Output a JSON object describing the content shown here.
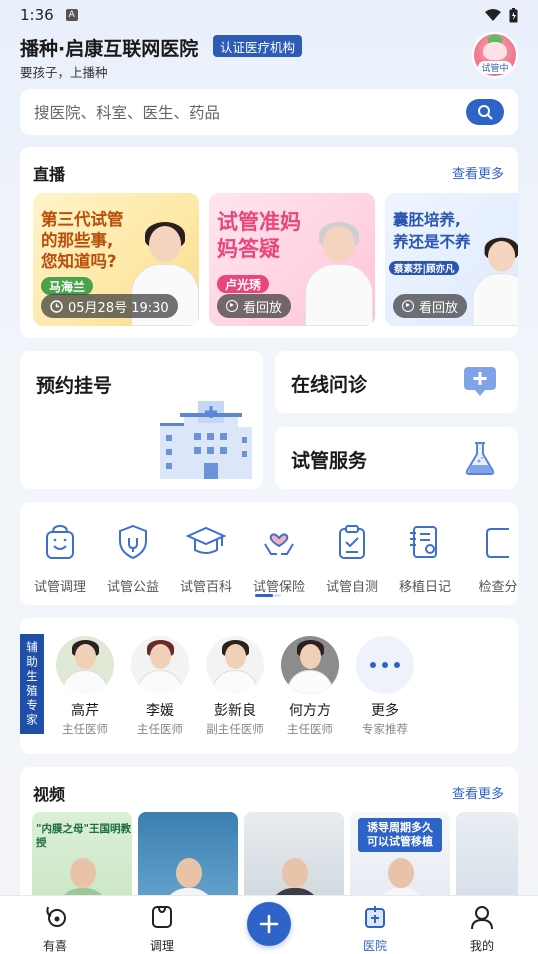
{
  "status_bar": {
    "time": "1:36"
  },
  "header": {
    "title": "播种·启康互联网医院",
    "badge": "认证医疗机构",
    "slogan": "要孩子，上播种",
    "avatar_tag": "试管中"
  },
  "search": {
    "placeholder": "搜医院、科室、医生、药品"
  },
  "live": {
    "title": "直播",
    "more": "查看更多",
    "items": [
      {
        "headline": [
          "第三代试管",
          "的那些事,",
          "您知道吗?"
        ],
        "doctor": "马海兰",
        "time": "05月28号 19:30"
      },
      {
        "headline": [
          "试管准妈",
          "妈答疑"
        ],
        "doctor": "卢光琇",
        "action": "看回放"
      },
      {
        "headline": [
          "囊胚培养,",
          "养还是不养"
        ],
        "doctor": "蔡素芬|顾亦凡",
        "action": "看回放"
      }
    ]
  },
  "services": {
    "appointment": "预约挂号",
    "consultation": "在线问诊",
    "ivf_service": "试管服务"
  },
  "grid": {
    "items": [
      {
        "label": "试管调理",
        "icon": "bag-smile-icon"
      },
      {
        "label": "试管公益",
        "icon": "shield-heart-icon"
      },
      {
        "label": "试管百科",
        "icon": "graduation-cap-icon"
      },
      {
        "label": "试管保险",
        "icon": "hand-heart-icon"
      },
      {
        "label": "试管自测",
        "icon": "clipboard-check-icon"
      },
      {
        "label": "移植日记",
        "icon": "diary-icon"
      },
      {
        "label": "检查分",
        "icon": "report-icon"
      }
    ]
  },
  "experts": {
    "tag": "辅助生殖专家",
    "items": [
      {
        "name": "高芹",
        "role": "主任医师"
      },
      {
        "name": "李媛",
        "role": "主任医师"
      },
      {
        "name": "彭新良",
        "role": "副主任医师"
      },
      {
        "name": "何方方",
        "role": "主任医师"
      },
      {
        "name": "更多",
        "role": "专家推荐"
      }
    ]
  },
  "videos": {
    "title": "视频",
    "more": "查看更多",
    "items": [
      {
        "text": "\"内膜之母\"王国明教授"
      },
      {
        "text": ""
      },
      {
        "text": ""
      },
      {
        "text": "诱导周期多久可以试管移植"
      },
      {
        "text": ""
      }
    ]
  },
  "tabs": [
    {
      "label": "有喜",
      "icon": "baby-icon"
    },
    {
      "label": "调理",
      "icon": "cup-icon"
    },
    {
      "label": "医院",
      "icon": "hospital-icon",
      "active": true
    },
    {
      "label": "我的",
      "icon": "person-icon"
    }
  ],
  "colors": {
    "primary": "#2e63c8",
    "badge": "#2c5bb8",
    "expert_tag": "#1f4fa8"
  }
}
